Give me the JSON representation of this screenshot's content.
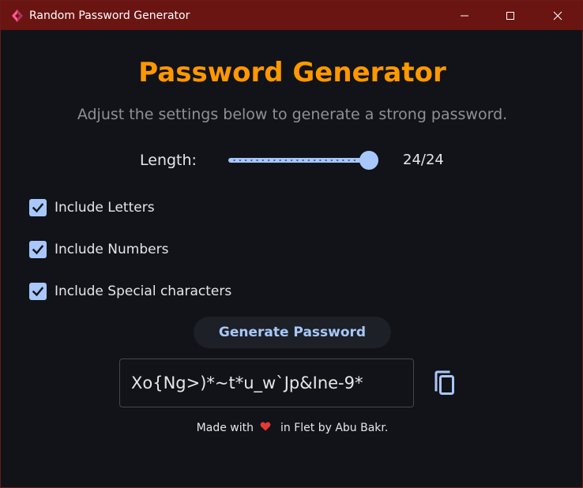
{
  "window": {
    "title": "Random Password Generator",
    "titlebar_color": "#6a1512",
    "icons": {
      "app": "flet-logo-icon",
      "minimize": "minimize-icon",
      "maximize": "maximize-icon",
      "close": "close-icon"
    }
  },
  "main": {
    "heading": "Password Generator",
    "subtitle": "Adjust the settings below to generate a strong password.",
    "accent_color": "#ff9800",
    "primary_color": "#a8c7fa"
  },
  "length": {
    "label": "Length:",
    "value": 24,
    "max": 24,
    "display": "24/24"
  },
  "options": [
    {
      "label": "Include Letters",
      "checked": true
    },
    {
      "label": "Include Numbers",
      "checked": true
    },
    {
      "label": "Include Special characters",
      "checked": true
    }
  ],
  "generate_button": {
    "label": "Generate Password"
  },
  "password": {
    "value": "Xo{Ng>)*~t*u_w`Jp&Ine-9*"
  },
  "copy_button": {
    "icon": "copy-icon"
  },
  "footer": {
    "before": "Made with",
    "icon": "heart-icon",
    "heart_color": "#e53935",
    "after": "in Flet by Abu Bakr."
  }
}
